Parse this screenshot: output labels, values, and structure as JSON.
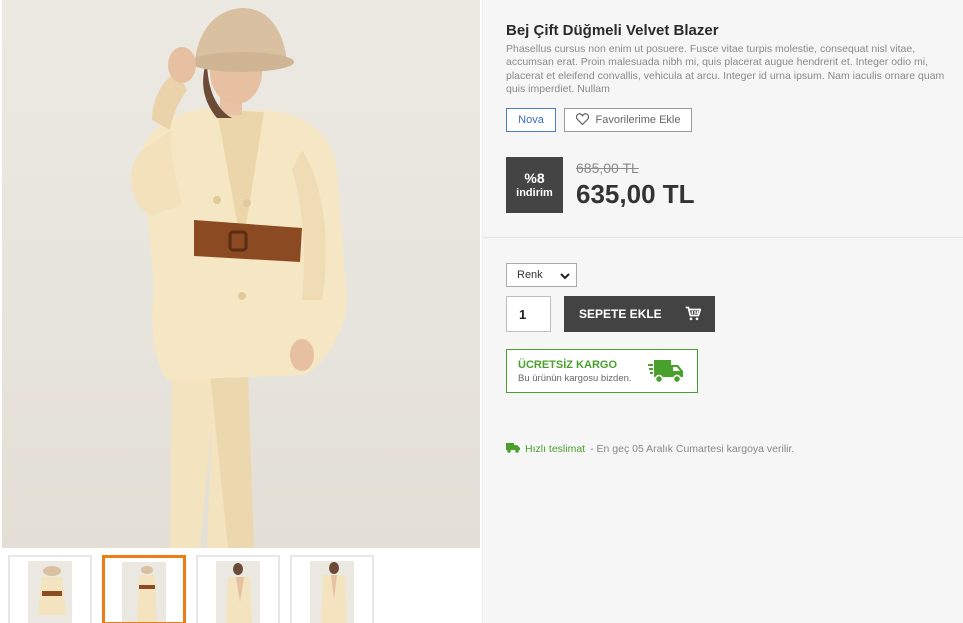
{
  "product": {
    "title": "Bej Çift Düğmeli Velvet Blazer",
    "description": "Phasellus cursus non enim ut posuere. Fusce vitae turpis molestie, consequat nisl vitae, accumsan erat. Proin malesuada nibh mi, quis placerat augue hendrerit et. Integer odio mi, placerat et eleifend convallis, vehicula at arcu. Integer id urna ipsum. Nam iaculis ornare quam quis imperdiet. Nullam",
    "brand_label": "Nova",
    "favorite_label": "Favorilerime Ekle"
  },
  "price": {
    "discount_percent": "%8",
    "discount_label": "indirim",
    "old_price": "685,00 TL",
    "new_price": "635,00 TL"
  },
  "options": {
    "color_select": "Renk",
    "quantity": "1",
    "add_to_cart_label": "SEPETE EKLE"
  },
  "cargo": {
    "title": "ÜCRETSİZ KARGO",
    "subtitle": "Bu ürünün kargosu bizden."
  },
  "delivery": {
    "label": "Hızlı teslimat",
    "text": "- En geç 05 Aralık Cumartesi kargoya verilir."
  },
  "gallery": {
    "thumbnail_count": 4,
    "active_index": 1
  },
  "colors": {
    "accent_orange": "#f07d14",
    "green": "#4aa02c",
    "dark_button": "#434343",
    "brand_blue": "#3a6fb7"
  },
  "icons": [
    "heart-icon",
    "cart-icon",
    "truck-icon",
    "fast-delivery-truck-icon",
    "chevron-down-icon"
  ]
}
